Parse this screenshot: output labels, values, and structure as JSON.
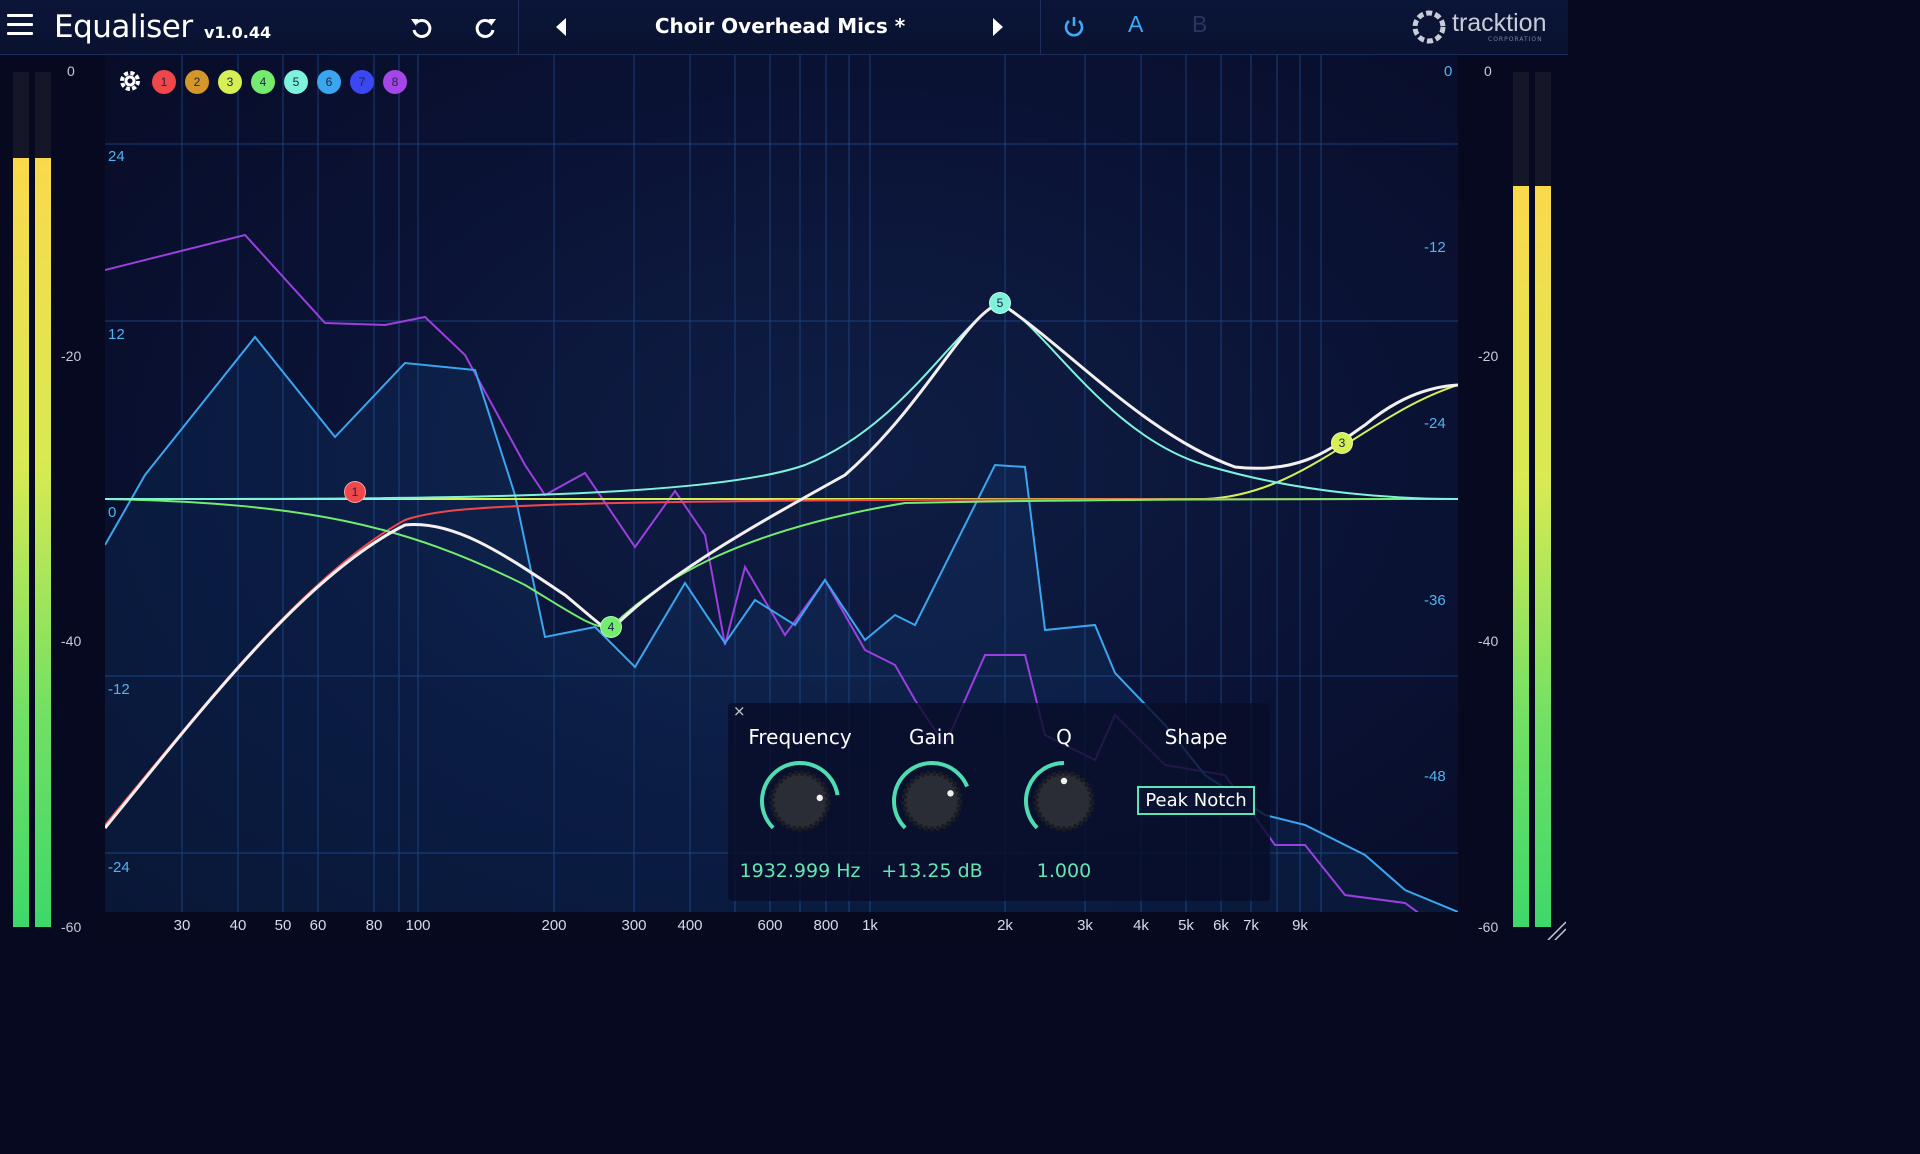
{
  "header": {
    "title": "Equaliser",
    "version": "v1.0.44",
    "preset_name": "Choir Overhead Mics *",
    "ab": {
      "a": "A",
      "b": "B"
    },
    "logo": "tracktion",
    "logo_sub": "CORPORATION"
  },
  "bands": [
    {
      "label": "1",
      "color": "#f0474b"
    },
    {
      "label": "2",
      "color": "#d4972a"
    },
    {
      "label": "3",
      "color": "#d4f055"
    },
    {
      "label": "4",
      "color": "#74ec70"
    },
    {
      "label": "5",
      "color": "#7ff2dc"
    },
    {
      "label": "6",
      "color": "#3aa6f0"
    },
    {
      "label": "7",
      "color": "#3b47f0"
    },
    {
      "label": "8",
      "color": "#a746e8"
    }
  ],
  "meters": {
    "left_scale": [
      "0",
      "-20",
      "-40",
      "-60"
    ],
    "right_scale": [
      "0",
      "-20",
      "-40",
      "-60"
    ],
    "left_levels_db": [
      -6,
      -6
    ],
    "right_levels_db": [
      -8,
      -8
    ]
  },
  "graph": {
    "gain_labels": [
      "24",
      "12",
      "0",
      "-12",
      "-24"
    ],
    "spectrum_labels": [
      "0",
      "-12",
      "-24",
      "-36",
      "-48"
    ],
    "freq_labels": [
      "30",
      "40",
      "50",
      "60",
      "80",
      "100",
      "200",
      "300",
      "400",
      "600",
      "800",
      "1k",
      "2k",
      "3k",
      "4k",
      "5k",
      "6k",
      "7k",
      "9k"
    ]
  },
  "panel": {
    "close": "×",
    "frequency": {
      "label": "Frequency",
      "value": "1932.999 Hz",
      "position": 0.8
    },
    "gain": {
      "label": "Gain",
      "value": "+13.25 dB",
      "position": 0.75
    },
    "q": {
      "label": "Q",
      "value": "1.000",
      "position": 0.5
    },
    "shape": {
      "label": "Shape",
      "value": "Peak Notch"
    }
  },
  "nodes": [
    {
      "label": "1",
      "color": "#f0474b"
    },
    {
      "label": "4",
      "color": "#74ec70"
    },
    {
      "label": "5",
      "color": "#7ff2dc"
    },
    {
      "label": "3",
      "color": "#d4f055"
    }
  ]
}
